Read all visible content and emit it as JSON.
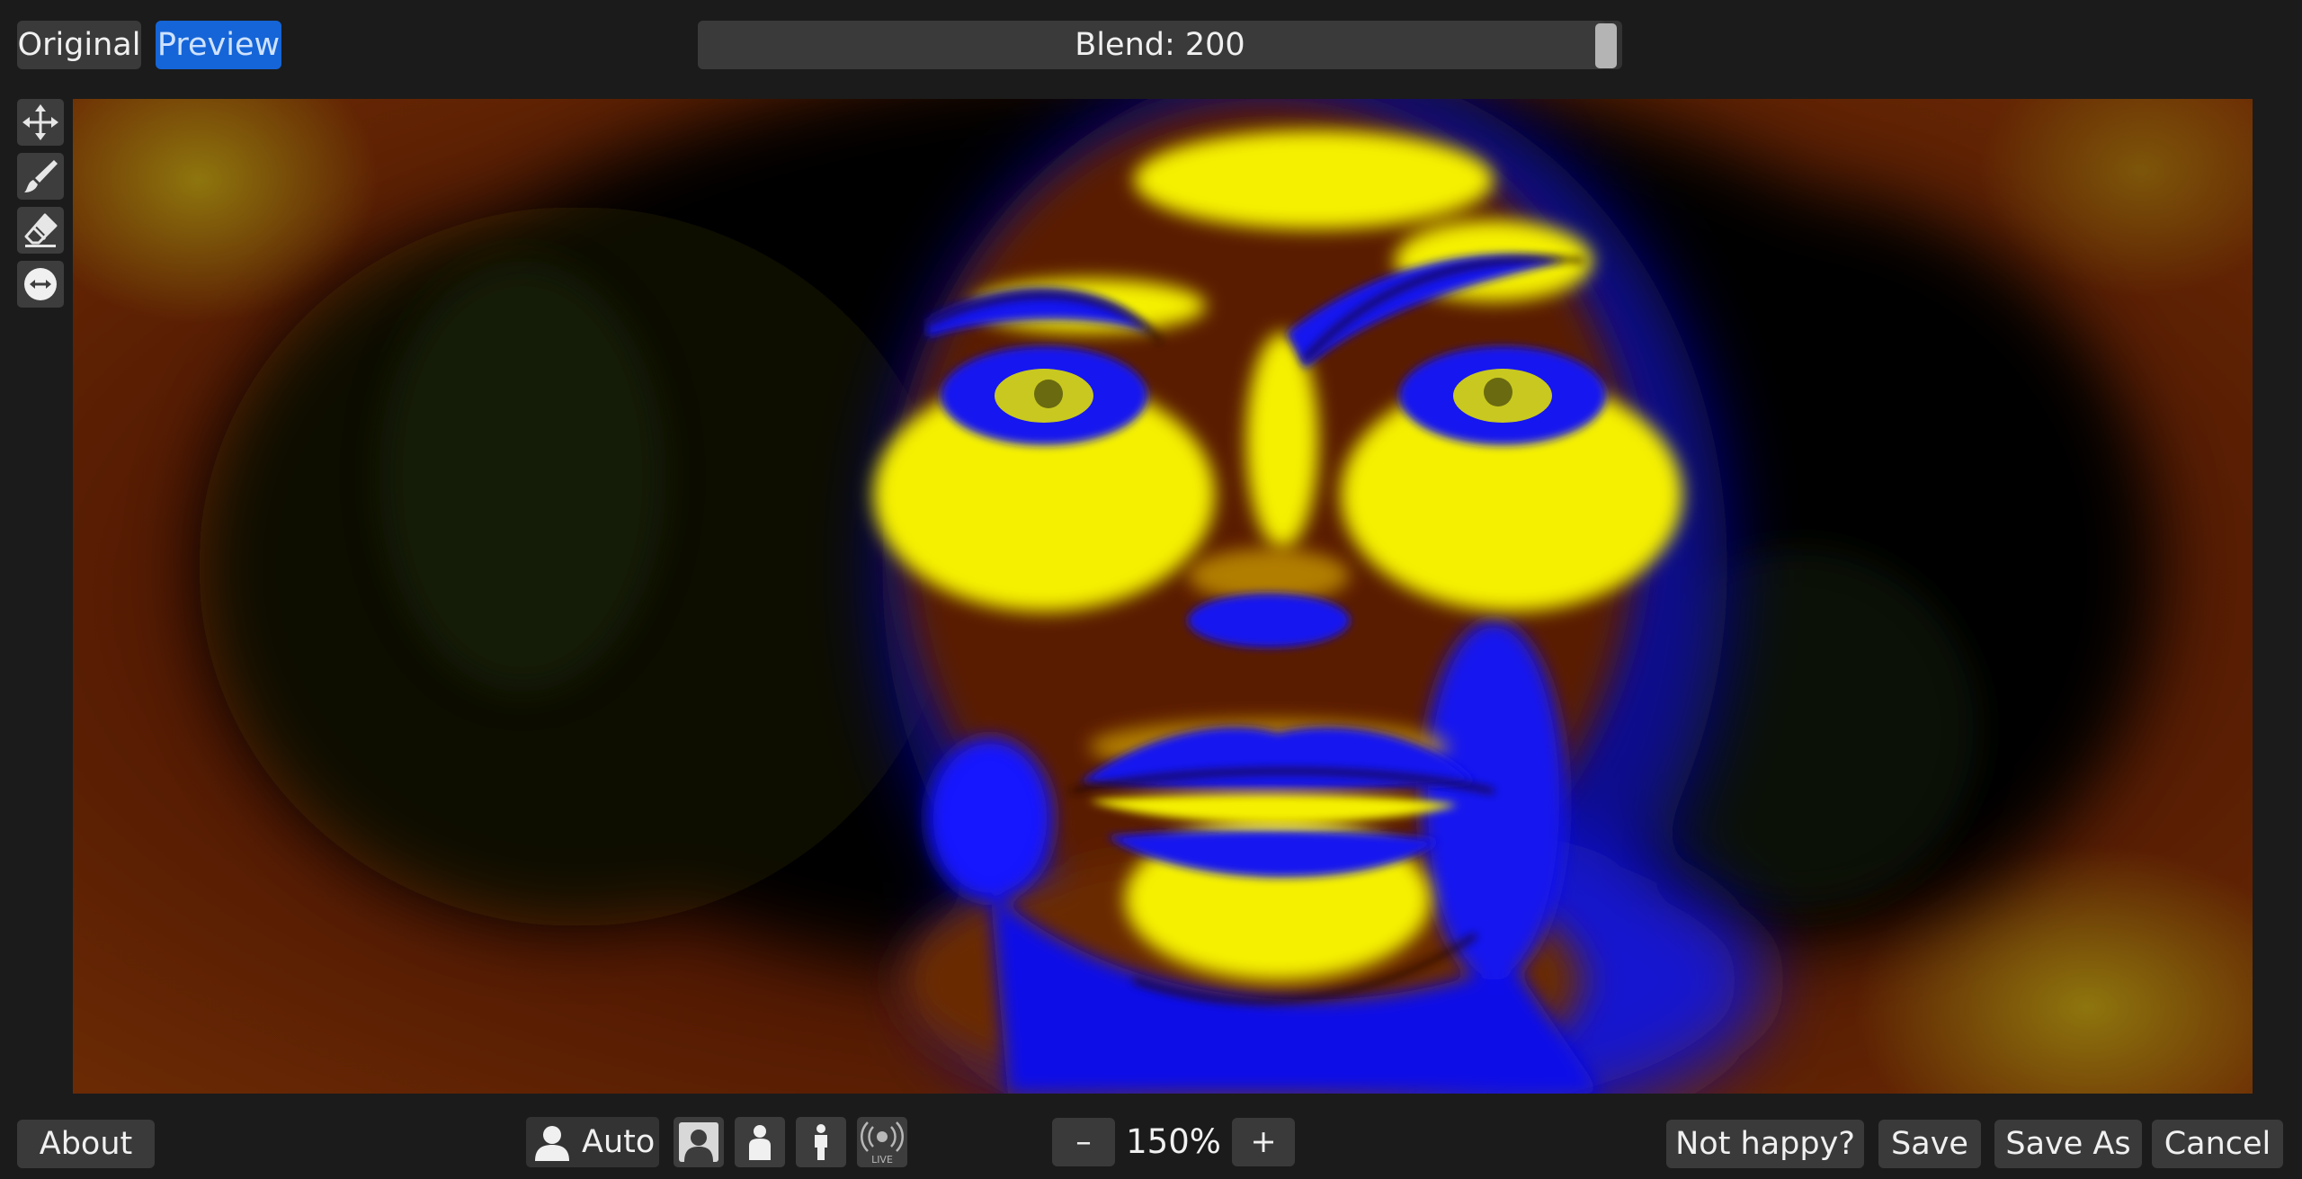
{
  "view_toggle": {
    "original_label": "Original",
    "preview_label": "Preview",
    "active": "Preview"
  },
  "blend_slider": {
    "label": "Blend: 200",
    "fraction": 1.0
  },
  "tools": [
    {
      "name": "move-icon"
    },
    {
      "name": "brush-icon"
    },
    {
      "name": "eraser-icon"
    },
    {
      "name": "adjust-icon"
    }
  ],
  "bottom": {
    "about_label": "About",
    "mode_auto_label": "Auto",
    "live_label": "LIVE",
    "zoom_out_label": "–",
    "zoom_value": "150%",
    "zoom_in_label": "+",
    "not_happy_label": "Not happy?",
    "save_label": "Save",
    "save_as_label": "Save As",
    "cancel_label": "Cancel"
  },
  "colors": {
    "accent": "#1565d8",
    "button_bg": "#3a3a3a",
    "app_bg": "#1b1b1b",
    "image_yellow": "#f5f000",
    "image_blue": "#1010e8",
    "image_brown": "#5e1e04"
  }
}
